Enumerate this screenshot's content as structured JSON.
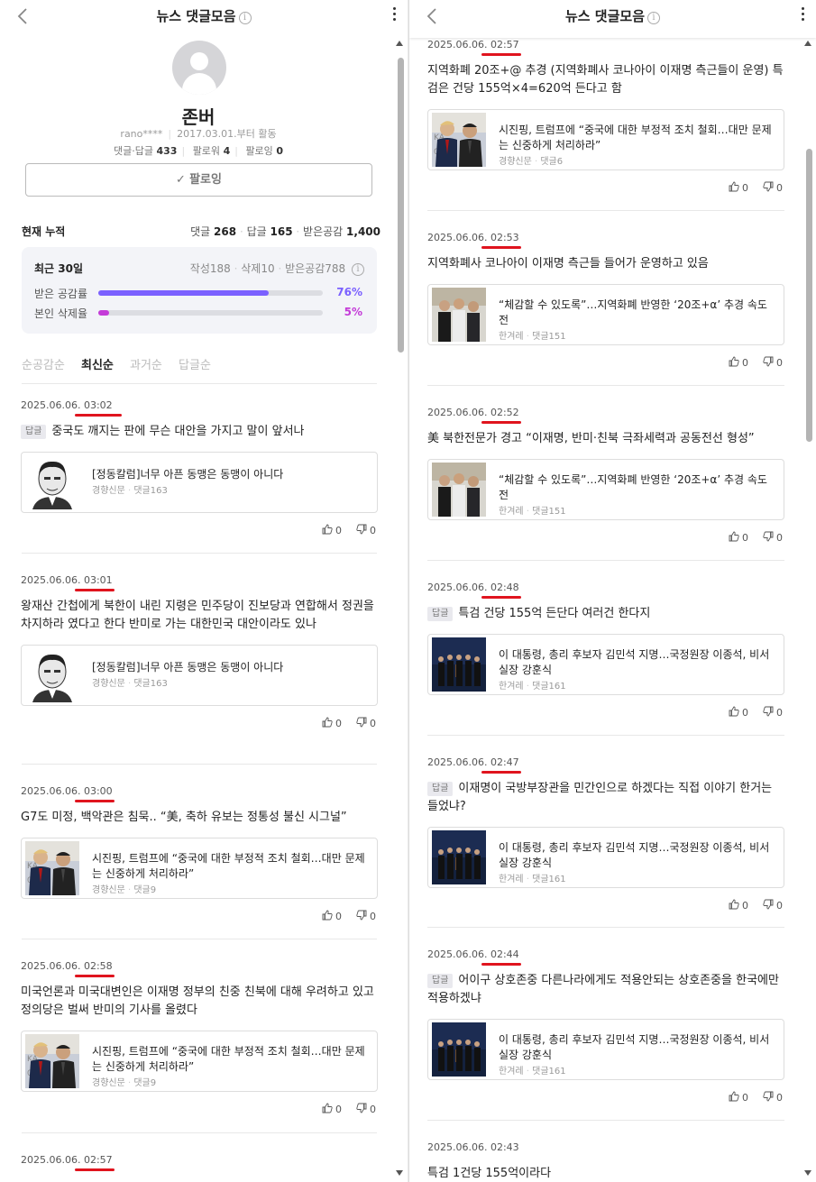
{
  "header": {
    "title": "뉴스 댓글모음"
  },
  "profile": {
    "name": "존버",
    "user_id": "rano****",
    "since": "2017.03.01.부터 활동",
    "stats": [
      {
        "label": "댓글·답글",
        "value": "433"
      },
      {
        "label": "팔로워",
        "value": "4"
      },
      {
        "label": "팔로잉",
        "value": "0"
      }
    ],
    "follow_label": "팔로잉"
  },
  "cumulative": {
    "label": "현재 누적",
    "comments_label": "댓글",
    "comments": "268",
    "replies_label": "답글",
    "replies": "165",
    "likes_label": "받은공감",
    "likes": "1,400"
  },
  "recent30": {
    "label": "최근 30일",
    "written_label": "작성",
    "written": "188",
    "deleted_label": "삭제",
    "deleted": "10",
    "likes_label": "받은공감",
    "likes": "788",
    "bars": [
      {
        "label": "받은 공감률",
        "value": 0.76,
        "text": "76%",
        "color": "#7b61ff"
      },
      {
        "label": "본인 삭제율",
        "value": 0.05,
        "text": "5%",
        "color": "#c43bd8"
      }
    ]
  },
  "sort_tabs": [
    "순공감순",
    "최신순",
    "과거순",
    "답글순"
  ],
  "left_comments": [
    {
      "date": "2025.06.06. 03:02",
      "reply": true,
      "text": "중국도 깨지는 판에 무슨 대안을 가지고 말이 앞서나",
      "article": {
        "title": "[정동칼럼]너무 아픈 동맹은 동맹이 아니다",
        "source": "경향신문",
        "count": "댓글163",
        "thumb": "portrait"
      },
      "up": "0",
      "down": "0"
    },
    {
      "date": "2025.06.06. 03:01",
      "reply": false,
      "text": "왕재산 간첩에게 북한이 내린 지령은 민주당이 진보당과 연합해서 정권을 차지하라 였다고 한다 반미로 가는 대한민국 대안이라도 있나",
      "article": {
        "title": "[정동칼럼]너무 아픈 동맹은 동맹이 아니다",
        "source": "경향신문",
        "count": "댓글163",
        "thumb": "portrait"
      },
      "up": "0",
      "down": "0"
    },
    {
      "date": "2025.06.06. 03:00",
      "reply": false,
      "text": "G7도 미정, 백악관은 침묵.. “美, 축하 유보는 정통성 불신 시그널”",
      "article": {
        "title": "시진핑, 트럼프에 “중국에 대한 부정적 조치 철회…대만 문제는 신중하게 처리하라”",
        "source": "경향신문",
        "count": "댓글9",
        "thumb": "leaders"
      },
      "up": "0",
      "down": "0"
    },
    {
      "date": "2025.06.06. 02:58",
      "reply": false,
      "text": "미국언론과 미국대변인은 이재명 정부의 친중 친북에 대해 우려하고 있고 정의당은 벌써 반미의 기사를 올렸다",
      "article": {
        "title": "시진핑, 트럼프에 “중국에 대한 부정적 조치 철회…대만 문제는 신중하게 처리하라”",
        "source": "경향신문",
        "count": "댓글9",
        "thumb": "leaders"
      },
      "up": "0",
      "down": "0"
    },
    {
      "date": "2025.06.06. 02:57"
    }
  ],
  "right_comments": [
    {
      "date": "2025.06.06. 02:57",
      "reply": false,
      "text": "지역화폐 20조+@ 추경 (지역화폐사 코나아이 이재명 측근들이 운영) 특검은 건당 155억×4=620억 든다고 함",
      "article": {
        "title": "시진핑, 트럼프에 “중국에 대한 부정적 조치 철회…대만 문제는 신중하게 처리하라”",
        "source": "경향신문",
        "count": "댓글6",
        "thumb": "leaders"
      },
      "up": "0",
      "down": "0"
    },
    {
      "date": "2025.06.06. 02:53",
      "reply": false,
      "text": "지역화폐사 코나아이 이재명 측근들 들어가 운영하고 있음",
      "article": {
        "title": "“체감할 수 있도록”…지역화폐 반영한 ‘20조+α’ 추경 속도전",
        "source": "한겨레",
        "count": "댓글151",
        "thumb": "walk"
      },
      "up": "0",
      "down": "0"
    },
    {
      "date": "2025.06.06. 02:52",
      "reply": false,
      "text": "美 북한전문가 경고 “이재명, 반미·친북 극좌세력과 공동전선 형성”",
      "article": {
        "title": "“체감할 수 있도록”…지역화폐 반영한 ‘20조+α’ 추경 속도전",
        "source": "한겨레",
        "count": "댓글151",
        "thumb": "walk"
      },
      "up": "0",
      "down": "0"
    },
    {
      "date": "2025.06.06. 02:48",
      "reply": true,
      "text": "특검 건당 155억 든단다 여러건 한다지",
      "article": {
        "title": "이 대통령, 총리 후보자 김민석 지명…국정원장 이종석, 비서실장 강훈식",
        "source": "한겨레",
        "count": "댓글161",
        "thumb": "podium"
      },
      "up": "0",
      "down": "0"
    },
    {
      "date": "2025.06.06. 02:47",
      "reply": true,
      "text": "이재명이 국방부장관을 민간인으로 하겠다는 직접 이야기 한거는 들었냐?",
      "article": {
        "title": "이 대통령, 총리 후보자 김민석 지명…국정원장 이종석, 비서실장 강훈식",
        "source": "한겨레",
        "count": "댓글161",
        "thumb": "podium"
      },
      "up": "0",
      "down": "0"
    },
    {
      "date": "2025.06.06. 02:44",
      "reply": true,
      "text": "어이구 상호존중 다른나라에게도 적용안되는 상호존중을 한국에만 적용하겠냐",
      "article": {
        "title": "이 대통령, 총리 후보자 김민석 지명…국정원장 이종석, 비서실장 강훈식",
        "source": "한겨레",
        "count": "댓글161",
        "thumb": "podium"
      },
      "up": "0",
      "down": "0"
    },
    {
      "date": "2025.06.06. 02:43",
      "text_partial": "특검 1건당 155억이라다"
    }
  ],
  "reply_badge": "답글",
  "colors": {
    "highlight": "#e0141e",
    "like_bar": "#7b61ff",
    "delete_bar": "#c43bd8"
  }
}
